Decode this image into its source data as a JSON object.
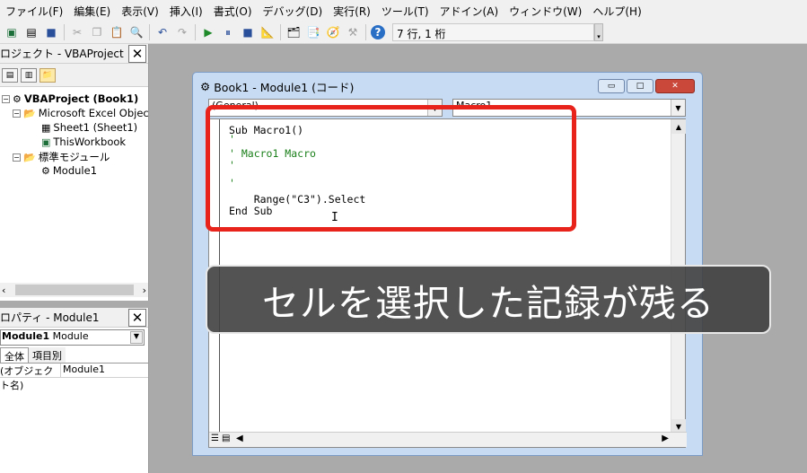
{
  "menu": [
    "ファイル(F)",
    "編集(E)",
    "表示(V)",
    "挿入(I)",
    "書式(O)",
    "デバッグ(D)",
    "実行(R)",
    "ツール(T)",
    "アドイン(A)",
    "ウィンドウ(W)",
    "ヘルプ(H)"
  ],
  "toolbar": {
    "position": "7 行, 1 桁"
  },
  "project_panel": {
    "title": "ロジェクト - VBAProject",
    "nodes": [
      "VBAProject (Book1)",
      "Microsoft Excel Object",
      "Sheet1 (Sheet1)",
      "ThisWorkbook",
      "標準モジュール",
      "Module1"
    ]
  },
  "props_panel": {
    "title": "ロパティ - Module1",
    "object": "Module1",
    "object_type": "Module",
    "tabs": [
      "全体",
      "項目別"
    ],
    "row_name": "(オブジェクト名)",
    "row_value": "Module1"
  },
  "code_window": {
    "title": "Book1 - Module1 (コード)",
    "combo_left": "(General)",
    "combo_right": "Macro1",
    "lines": [
      "Sub Macro1()",
      "'",
      "' Macro1 Macro",
      "'",
      "",
      "'",
      "    Range(\"C3\").Select",
      "End Sub"
    ]
  },
  "caption": "セルを選択した記録が残る"
}
